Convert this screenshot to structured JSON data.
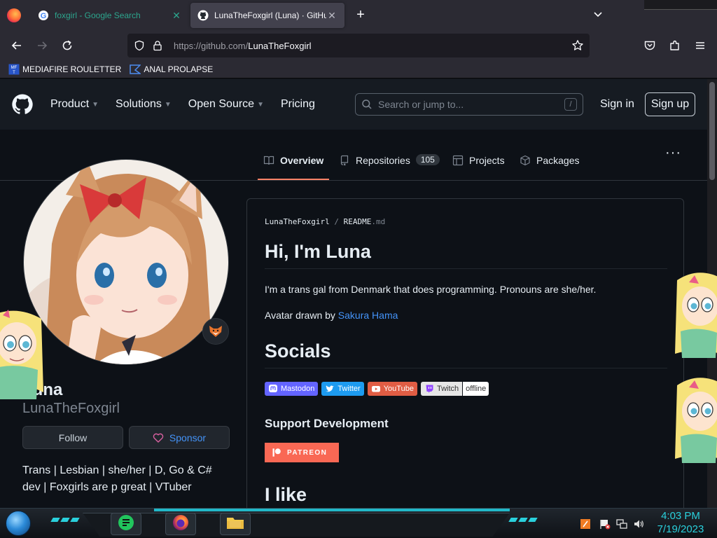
{
  "browser": {
    "tabs": [
      {
        "label": "foxgirl - Google Search",
        "active": false,
        "close": "✕"
      },
      {
        "label": "LunaTheFoxgirl (Luna) · GitHub",
        "active": true,
        "close": "✕"
      }
    ],
    "new_tab": "+",
    "url_host": "https://github.com/",
    "url_path": "LunaTheFoxgirl",
    "bookmarks": [
      {
        "label": "MEDIAFIRE ROULETTER",
        "icon": "mf-icon"
      },
      {
        "label": "ANAL PROLAPSE",
        "icon": "triangle-icon"
      }
    ],
    "colors": {
      "chrome": "#2b2a33",
      "urlbar": "#1c1b22",
      "tab_active": "#42414d"
    }
  },
  "github": {
    "nav": [
      {
        "label": "Product",
        "chevron": "⌄"
      },
      {
        "label": "Solutions",
        "chevron": "⌄"
      },
      {
        "label": "Open Source",
        "chevron": "⌄"
      },
      {
        "label": "Pricing",
        "chevron": ""
      }
    ],
    "search_placeholder": "Search or jump to...",
    "search_shortcut": "/",
    "sign_in": "Sign in",
    "sign_up": "Sign up",
    "profile_tabs": [
      {
        "label": "Overview",
        "icon": "book-icon",
        "selected": true,
        "count": ""
      },
      {
        "label": "Repositories",
        "icon": "repo-icon",
        "selected": false,
        "count": "105"
      },
      {
        "label": "Projects",
        "icon": "table-icon",
        "selected": false,
        "count": ""
      },
      {
        "label": "Packages",
        "icon": "package-icon",
        "selected": false,
        "count": ""
      }
    ],
    "more": "···",
    "colors": {
      "bg": "#0d1117",
      "header": "#161b22",
      "border": "#30363d",
      "link": "#4493f8",
      "tab_underline": "#f78166"
    }
  },
  "profile": {
    "name": "Luna",
    "login": "LunaTheFoxgirl",
    "follow_label": "Follow",
    "sponsor_label": "Sponsor",
    "bio": "Trans | Lesbian | she/her | D, Go & C# dev | Foxgirls are p great | VTuber"
  },
  "readme": {
    "crumb_owner": "LunaTheFoxgirl",
    "crumb_sep": "/",
    "crumb_file": "README",
    "crumb_ext": ".md",
    "heading": "Hi, I'm Luna",
    "intro": "I'm a trans gal from Denmark that does programming. Pronouns are she/her.",
    "avatar_credit_prefix": "Avatar drawn by ",
    "avatar_credit_link": "Sakura Hama",
    "socials_heading": "Socials",
    "badges": [
      {
        "label": "Mastodon",
        "color": "#6364ff",
        "icon": "mastodon-icon"
      },
      {
        "label": "Twitter",
        "color": "#1d9bf0",
        "icon": "twitter-icon"
      },
      {
        "label": "YouTube",
        "color": "#e05d44",
        "icon": "youtube-icon"
      },
      {
        "label": "Twitch",
        "color": "#e6e6e6",
        "icon": "twitch-icon"
      }
    ],
    "twitch_status": "offline",
    "support_heading": "Support Development",
    "patreon_label": "PATREON",
    "like_heading": "I like"
  },
  "taskbar": {
    "apps": [
      {
        "name": "notes-app",
        "icon": "notes-icon"
      },
      {
        "name": "firefox-app",
        "icon": "firefox-icon"
      },
      {
        "name": "explorer-app",
        "icon": "folder-icon"
      }
    ],
    "time": "4:03 PM",
    "date": "7/19/2023",
    "accent": "#2ad0dc"
  }
}
